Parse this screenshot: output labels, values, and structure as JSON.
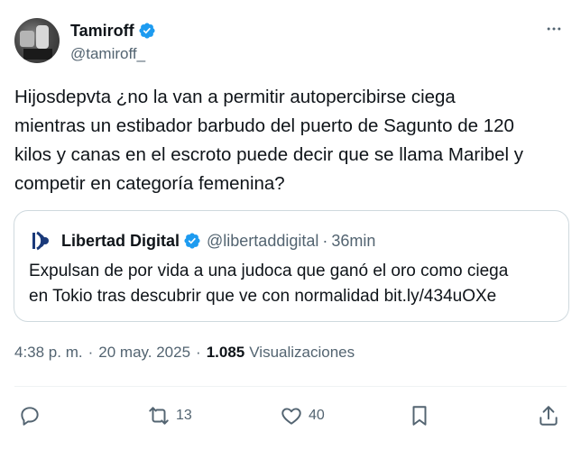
{
  "author": {
    "display_name": "Tamiroff",
    "handle": "@tamiroff_",
    "verified_icon": "verified-badge-icon"
  },
  "more_icon": "more-options-icon",
  "tweet": {
    "text": "Hijosdepvta ¿no la van a permitir autopercibirse ciega\nmientras un estibador barbudo del puerto de Sagunto de 120\nkilos y canas en el escroto puede decir que se llama Maribel y\ncompetir en categoría femenina?"
  },
  "quote": {
    "display_name": "Libertad Digital",
    "handle": "@libertaddigital",
    "separator": "·",
    "time": "36min",
    "text": "Expulsan de por vida a una judoca que ganó el oro como ciega\nen Tokio tras descubrir que ve con normalidad bit.ly/434uOXe"
  },
  "meta": {
    "time": "4:38 p. m.",
    "separator": "·",
    "date": "20 may. 2025",
    "views_count": "1.085",
    "views_label": "Visualizaciones"
  },
  "actions": {
    "reply_count": "",
    "retweet_count": "13",
    "like_count": "40"
  },
  "colors": {
    "text": "#0f1419",
    "secondary": "#536471",
    "verified_blue": "#1d9bf0",
    "border": "#cfd9de",
    "ld_blue": "#1a3a7a"
  }
}
